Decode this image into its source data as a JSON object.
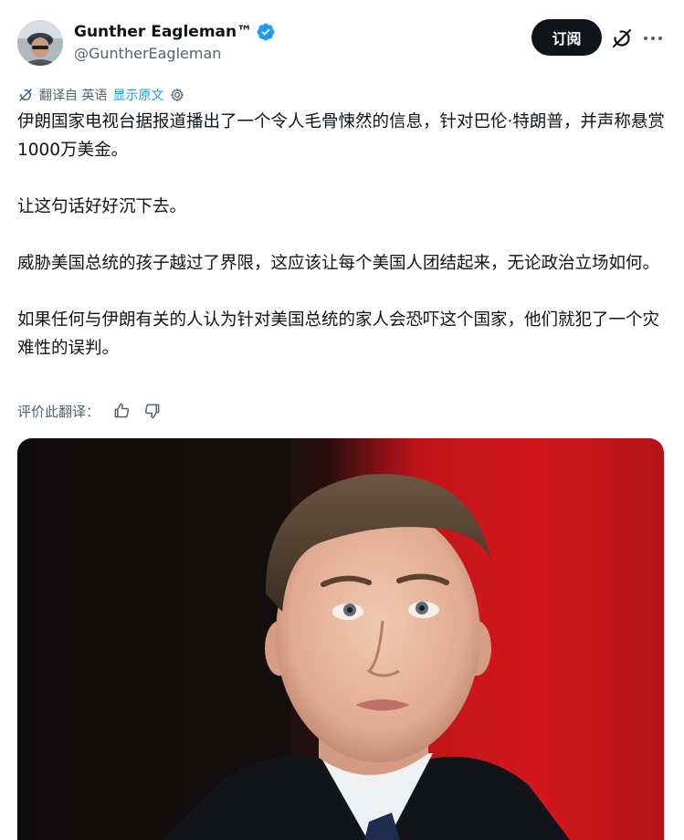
{
  "author": {
    "display_name": "Gunther Eagleman™",
    "handle": "@GuntherEagleman",
    "verified": true
  },
  "actions": {
    "subscribe_label": "订阅",
    "grok_icon": "grok-icon",
    "more_icon": "more-icon"
  },
  "translation": {
    "label": "翻译自 英语",
    "show_original": "显示原文",
    "rate_label": "评价此翻译："
  },
  "body": {
    "paragraphs": [
      "伊朗国家电视台据报道播出了一个令人毛骨悚然的信息，针对巴伦·特朗普，并声称悬赏1000万美金。",
      "让这句话好好沉下去。",
      "威胁美国总统的孩子越过了界限，这应该让每个美国人团结起来，无论政治立场如何。",
      "如果任何与伊朗有关的人认为针对美国总统的家人会恐吓这个国家，他们就犯了一个灾难性的误判。"
    ]
  },
  "colors": {
    "text": "#0f1419",
    "muted": "#536471",
    "link": "#1d9bf0",
    "button_bg": "#0f1419",
    "verified_badge": "#1d9bf0",
    "media_red": "#d3171d"
  }
}
